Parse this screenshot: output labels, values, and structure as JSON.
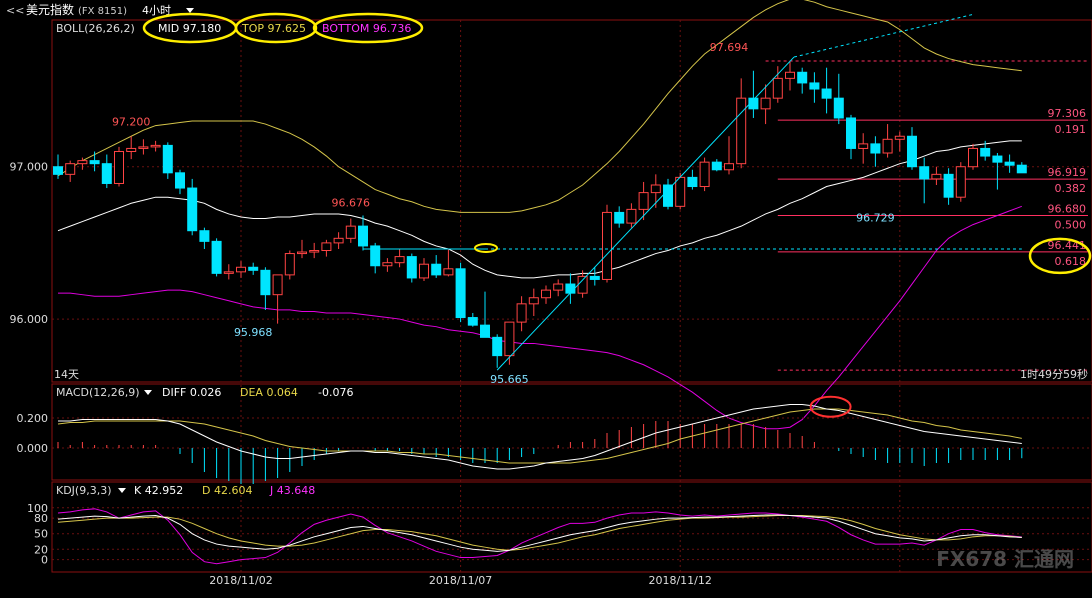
{
  "header": {
    "back_label": "<<",
    "symbol": "美元指数",
    "code": "(FX 8151)",
    "period": "4小时"
  },
  "boll": {
    "label": "BOLL(26,26,2)",
    "mid": "MID 97.180",
    "top": "TOP 97.625",
    "bottom": "BOTTOM 96.736"
  },
  "price_axis": {
    "ticks": [
      {
        "label": "97.000",
        "value": 97.0
      },
      {
        "label": "96.000",
        "value": 96.0
      }
    ],
    "ylim": [
      95.6,
      97.95
    ]
  },
  "fib_levels": [
    {
      "price": 97.694,
      "ratio": ""
    },
    {
      "price": 97.306,
      "ratio": "0.191"
    },
    {
      "price": 96.919,
      "ratio": "0.382"
    },
    {
      "price": 96.68,
      "ratio": "0.500"
    },
    {
      "price": 96.441,
      "ratio": "0.618"
    },
    {
      "price": 95.665,
      "ratio": ""
    }
  ],
  "annotations": [
    {
      "text": "97.200",
      "x": 6,
      "y": 97.27,
      "color": "#ff5555"
    },
    {
      "text": "96.676",
      "x": 24,
      "y": 96.74,
      "color": "#ff5555"
    },
    {
      "text": "95.968",
      "x": 16,
      "y": 95.89,
      "color": "#7fe0ff"
    },
    {
      "text": "95.665",
      "x": 37,
      "y": 95.58,
      "color": "#7fe0ff"
    },
    {
      "text": "97.694",
      "x": 55,
      "y": 97.76,
      "color": "#ff5555"
    },
    {
      "text": "96.729",
      "x": 67,
      "y": 96.64,
      "color": "#7fe0ff"
    }
  ],
  "panel_labels": {
    "bars_count": "14天",
    "countdown": "1时49分59秒"
  },
  "macd": {
    "label": "MACD(12,26,9)",
    "diff": "DIFF 0.026",
    "dea": "DEA 0.064",
    "macd_value": "-0.076",
    "ticks": [
      {
        "label": "0.200",
        "value": 0.2
      },
      {
        "label": "0.000",
        "value": 0.0
      }
    ],
    "ylim": [
      -0.2,
      0.32
    ]
  },
  "kdj": {
    "label": "KDJ(9,3,3)",
    "k": "K 42.952",
    "d": "D 42.604",
    "j": "J 43.648",
    "ticks": [
      {
        "label": "100",
        "value": 100
      },
      {
        "label": "80",
        "value": 80
      },
      {
        "label": "50",
        "value": 50
      },
      {
        "label": "20",
        "value": 20
      },
      {
        "label": "0",
        "value": 0
      }
    ],
    "ylim": [
      -20,
      115
    ]
  },
  "x_axis": {
    "labels": [
      {
        "text": "2018/11/02",
        "x": 15
      },
      {
        "text": "2018/11/07",
        "x": 33
      },
      {
        "text": "2018/11/12",
        "x": 51
      }
    ]
  },
  "watermark": "FX678 汇通网",
  "colors": {
    "up": "#ff4444",
    "down": "#00e5ff",
    "mid_line": "#ffffff",
    "top_line": "#d4c44a",
    "bottom_line": "#e000e0",
    "grid": "#6a1010",
    "fib": "#ff3060",
    "trend": "#00e5ff",
    "highlight_yellow": "#ffee00",
    "highlight_red": "#ff3030"
  },
  "chart_data": {
    "type": "candlestick",
    "candles": [
      [
        97.0,
        97.08,
        96.92,
        96.95
      ],
      [
        96.95,
        97.04,
        96.9,
        97.02
      ],
      [
        97.02,
        97.06,
        96.98,
        97.04
      ],
      [
        97.04,
        97.1,
        96.97,
        97.02
      ],
      [
        97.02,
        97.08,
        96.86,
        96.89
      ],
      [
        96.89,
        97.13,
        96.87,
        97.1
      ],
      [
        97.1,
        97.2,
        97.05,
        97.12
      ],
      [
        97.12,
        97.18,
        97.08,
        97.13
      ],
      [
        97.13,
        97.17,
        97.1,
        97.14
      ],
      [
        97.14,
        97.16,
        96.92,
        96.96
      ],
      [
        96.96,
        96.98,
        96.82,
        96.86
      ],
      [
        96.86,
        96.92,
        96.55,
        96.58
      ],
      [
        96.58,
        96.6,
        96.46,
        96.51
      ],
      [
        96.51,
        96.53,
        96.28,
        96.3
      ],
      [
        96.3,
        96.36,
        96.26,
        96.31
      ],
      [
        96.31,
        96.38,
        96.27,
        96.34
      ],
      [
        96.34,
        96.37,
        96.29,
        96.32
      ],
      [
        96.32,
        96.34,
        96.06,
        96.16
      ],
      [
        96.16,
        96.2,
        95.97,
        96.29
      ],
      [
        96.29,
        96.45,
        96.26,
        96.43
      ],
      [
        96.43,
        96.52,
        96.4,
        96.44
      ],
      [
        96.44,
        96.5,
        96.4,
        96.45
      ],
      [
        96.45,
        96.52,
        96.41,
        96.5
      ],
      [
        96.5,
        96.57,
        96.46,
        96.53
      ],
      [
        96.53,
        96.66,
        96.5,
        96.61
      ],
      [
        96.61,
        96.68,
        96.45,
        96.48
      ],
      [
        96.48,
        96.5,
        96.3,
        96.35
      ],
      [
        96.35,
        96.4,
        96.31,
        96.37
      ],
      [
        96.37,
        96.46,
        96.34,
        96.41
      ],
      [
        96.41,
        96.43,
        96.24,
        96.27
      ],
      [
        96.27,
        96.4,
        96.25,
        96.36
      ],
      [
        96.36,
        96.42,
        96.27,
        96.29
      ],
      [
        96.29,
        96.46,
        96.28,
        96.33
      ],
      [
        96.33,
        96.37,
        95.98,
        96.01
      ],
      [
        96.01,
        96.04,
        95.95,
        95.96
      ],
      [
        95.96,
        96.18,
        95.9,
        95.88
      ],
      [
        95.88,
        95.9,
        95.68,
        95.76
      ],
      [
        95.76,
        95.92,
        95.7,
        95.98
      ],
      [
        95.98,
        96.15,
        95.92,
        96.1
      ],
      [
        96.1,
        96.2,
        96.02,
        96.14
      ],
      [
        96.14,
        96.22,
        96.1,
        96.19
      ],
      [
        96.19,
        96.26,
        96.15,
        96.23
      ],
      [
        96.23,
        96.3,
        96.1,
        96.17
      ],
      [
        96.17,
        96.32,
        96.14,
        96.28
      ],
      [
        96.28,
        96.34,
        96.22,
        96.26
      ],
      [
        96.26,
        96.75,
        96.24,
        96.7
      ],
      [
        96.7,
        96.74,
        96.6,
        96.63
      ],
      [
        96.63,
        96.76,
        96.6,
        96.72
      ],
      [
        96.72,
        96.9,
        96.65,
        96.83
      ],
      [
        96.83,
        96.95,
        96.73,
        96.88
      ],
      [
        96.88,
        96.92,
        96.72,
        96.74
      ],
      [
        96.74,
        96.96,
        96.72,
        96.93
      ],
      [
        96.93,
        96.98,
        96.85,
        96.87
      ],
      [
        96.87,
        97.06,
        96.84,
        97.03
      ],
      [
        97.03,
        97.05,
        96.97,
        96.98
      ],
      [
        96.98,
        97.2,
        96.95,
        97.02
      ],
      [
        97.02,
        97.58,
        96.99,
        97.45
      ],
      [
        97.45,
        97.63,
        97.32,
        97.38
      ],
      [
        97.38,
        97.54,
        97.28,
        97.45
      ],
      [
        97.45,
        97.66,
        97.42,
        97.58
      ],
      [
        97.58,
        97.69,
        97.5,
        97.62
      ],
      [
        97.62,
        97.65,
        97.48,
        97.55
      ],
      [
        97.55,
        97.62,
        97.42,
        97.51
      ],
      [
        97.51,
        97.65,
        97.35,
        97.45
      ],
      [
        97.45,
        97.61,
        97.28,
        97.32
      ],
      [
        97.32,
        97.34,
        97.05,
        97.12
      ],
      [
        97.12,
        97.22,
        97.02,
        97.15
      ],
      [
        97.15,
        97.2,
        97.0,
        97.09
      ],
      [
        97.09,
        97.28,
        97.06,
        97.18
      ],
      [
        97.18,
        97.23,
        97.1,
        97.2
      ],
      [
        97.2,
        97.26,
        96.98,
        97.0
      ],
      [
        97.0,
        97.06,
        96.76,
        96.92
      ],
      [
        96.92,
        97.0,
        96.88,
        96.95
      ],
      [
        96.95,
        96.99,
        96.75,
        96.8
      ],
      [
        96.8,
        97.03,
        96.77,
        97.0
      ],
      [
        97.0,
        97.15,
        96.98,
        97.12
      ],
      [
        97.12,
        97.17,
        97.04,
        97.07
      ],
      [
        97.07,
        97.09,
        96.85,
        97.03
      ],
      [
        97.03,
        97.08,
        96.96,
        97.01
      ],
      [
        97.01,
        97.03,
        96.96,
        96.96
      ]
    ],
    "boll_mid": [
      96.58,
      96.61,
      96.64,
      96.67,
      96.7,
      96.73,
      96.76,
      96.78,
      96.8,
      96.8,
      96.79,
      96.78,
      96.76,
      96.72,
      96.69,
      96.67,
      96.66,
      96.66,
      96.67,
      96.67,
      96.68,
      96.69,
      96.69,
      96.69,
      96.68,
      96.66,
      96.63,
      96.61,
      96.58,
      96.55,
      96.51,
      96.48,
      96.46,
      96.42,
      96.36,
      96.32,
      96.29,
      96.28,
      96.27,
      96.27,
      96.28,
      96.29,
      96.29,
      96.3,
      96.3,
      96.32,
      96.34,
      96.37,
      96.4,
      96.43,
      96.45,
      96.48,
      96.5,
      96.53,
      96.55,
      96.58,
      96.61,
      96.65,
      96.69,
      96.72,
      96.76,
      96.79,
      96.83,
      96.87,
      96.89,
      96.91,
      96.93,
      96.96,
      96.99,
      97.02,
      97.04,
      97.07,
      97.1,
      97.11,
      97.13,
      97.14,
      97.15,
      97.16,
      97.17,
      97.17
    ],
    "boll_top": [
      96.94,
      96.99,
      97.04,
      97.08,
      97.12,
      97.16,
      97.2,
      97.24,
      97.27,
      97.28,
      97.29,
      97.3,
      97.3,
      97.3,
      97.3,
      97.3,
      97.3,
      97.28,
      97.25,
      97.22,
      97.18,
      97.13,
      97.07,
      97.0,
      96.95,
      96.9,
      96.85,
      96.82,
      96.79,
      96.77,
      96.74,
      96.72,
      96.71,
      96.7,
      96.7,
      96.7,
      96.7,
      96.7,
      96.71,
      96.73,
      96.75,
      96.78,
      96.83,
      96.88,
      96.95,
      97.02,
      97.1,
      97.19,
      97.28,
      97.38,
      97.48,
      97.57,
      97.66,
      97.74,
      97.8,
      97.86,
      97.92,
      97.98,
      98.03,
      98.07,
      98.1,
      98.1,
      98.08,
      98.05,
      98.03,
      98.01,
      97.99,
      97.97,
      97.95,
      97.9,
      97.84,
      97.78,
      97.74,
      97.71,
      97.69,
      97.67,
      97.66,
      97.65,
      97.64,
      97.63
    ],
    "boll_bottom": [
      96.17,
      96.17,
      96.16,
      96.15,
      96.15,
      96.15,
      96.16,
      96.17,
      96.18,
      96.19,
      96.19,
      96.18,
      96.16,
      96.14,
      96.12,
      96.1,
      96.08,
      96.07,
      96.06,
      96.06,
      96.05,
      96.05,
      96.04,
      96.04,
      96.04,
      96.03,
      96.02,
      96.01,
      96.0,
      95.98,
      95.96,
      95.95,
      95.93,
      95.92,
      95.91,
      95.89,
      95.86,
      95.85,
      95.84,
      95.84,
      95.83,
      95.82,
      95.81,
      95.8,
      95.79,
      95.78,
      95.76,
      95.73,
      95.7,
      95.66,
      95.62,
      95.57,
      95.52,
      95.46,
      95.4,
      95.35,
      95.32,
      95.3,
      95.28,
      95.28,
      95.29,
      95.34,
      95.43,
      95.53,
      95.62,
      95.72,
      95.82,
      95.92,
      96.02,
      96.12,
      96.23,
      96.34,
      96.45,
      96.53,
      96.58,
      96.62,
      96.65,
      96.68,
      96.71,
      96.74
    ],
    "macd_diff": [
      0.18,
      0.18,
      0.19,
      0.19,
      0.19,
      0.19,
      0.19,
      0.19,
      0.19,
      0.18,
      0.16,
      0.12,
      0.08,
      0.04,
      0.01,
      -0.02,
      -0.04,
      -0.06,
      -0.07,
      -0.07,
      -0.06,
      -0.05,
      -0.04,
      -0.03,
      -0.02,
      -0.02,
      -0.03,
      -0.03,
      -0.04,
      -0.05,
      -0.06,
      -0.07,
      -0.08,
      -0.1,
      -0.12,
      -0.13,
      -0.14,
      -0.14,
      -0.13,
      -0.12,
      -0.1,
      -0.09,
      -0.08,
      -0.07,
      -0.05,
      -0.02,
      0.01,
      0.04,
      0.07,
      0.1,
      0.12,
      0.14,
      0.16,
      0.18,
      0.2,
      0.22,
      0.24,
      0.26,
      0.27,
      0.28,
      0.29,
      0.29,
      0.28,
      0.26,
      0.25,
      0.23,
      0.21,
      0.19,
      0.17,
      0.15,
      0.13,
      0.11,
      0.1,
      0.09,
      0.08,
      0.07,
      0.06,
      0.05,
      0.04,
      0.03
    ],
    "macd_dea": [
      0.16,
      0.17,
      0.17,
      0.18,
      0.18,
      0.18,
      0.18,
      0.18,
      0.18,
      0.18,
      0.18,
      0.17,
      0.16,
      0.14,
      0.12,
      0.1,
      0.08,
      0.05,
      0.03,
      0.01,
      0.0,
      -0.01,
      -0.02,
      -0.02,
      -0.02,
      -0.02,
      -0.02,
      -0.02,
      -0.03,
      -0.03,
      -0.04,
      -0.04,
      -0.05,
      -0.06,
      -0.07,
      -0.08,
      -0.09,
      -0.1,
      -0.1,
      -0.1,
      -0.1,
      -0.1,
      -0.1,
      -0.09,
      -0.08,
      -0.07,
      -0.05,
      -0.03,
      -0.01,
      0.01,
      0.03,
      0.06,
      0.08,
      0.1,
      0.12,
      0.14,
      0.16,
      0.18,
      0.2,
      0.22,
      0.24,
      0.25,
      0.26,
      0.26,
      0.26,
      0.25,
      0.24,
      0.23,
      0.22,
      0.2,
      0.18,
      0.17,
      0.15,
      0.14,
      0.12,
      0.11,
      0.1,
      0.09,
      0.08,
      0.064
    ],
    "kdj_k": [
      78,
      80,
      82,
      84,
      83,
      80,
      82,
      84,
      85,
      80,
      68,
      50,
      38,
      30,
      26,
      24,
      22,
      20,
      22,
      28,
      36,
      44,
      50,
      56,
      62,
      64,
      60,
      56,
      52,
      48,
      42,
      36,
      30,
      24,
      20,
      18,
      16,
      18,
      24,
      30,
      36,
      42,
      48,
      52,
      56,
      62,
      68,
      72,
      75,
      78,
      80,
      80,
      81,
      82,
      82,
      83,
      84,
      85,
      86,
      86,
      85,
      84,
      82,
      80,
      74,
      66,
      58,
      50,
      46,
      42,
      40,
      36,
      38,
      42,
      46,
      48,
      48,
      46,
      44,
      43
    ],
    "kdj_d": [
      72,
      74,
      76,
      78,
      80,
      80,
      80,
      81,
      82,
      82,
      78,
      70,
      60,
      50,
      42,
      36,
      32,
      28,
      26,
      26,
      28,
      32,
      38,
      44,
      50,
      56,
      58,
      58,
      56,
      54,
      50,
      46,
      40,
      34,
      28,
      24,
      20,
      18,
      20,
      24,
      28,
      32,
      38,
      44,
      48,
      54,
      60,
      64,
      68,
      72,
      76,
      78,
      80,
      80,
      81,
      82,
      82,
      83,
      84,
      85,
      85,
      85,
      84,
      83,
      80,
      75,
      68,
      60,
      54,
      48,
      44,
      40,
      38,
      38,
      40,
      44,
      46,
      46,
      45,
      42.6
    ],
    "kdj_j": [
      90,
      92,
      96,
      98,
      92,
      80,
      86,
      92,
      94,
      76,
      48,
      14,
      -4,
      -8,
      -4,
      0,
      2,
      4,
      14,
      32,
      52,
      68,
      76,
      82,
      88,
      82,
      66,
      52,
      44,
      36,
      26,
      16,
      10,
      4,
      4,
      6,
      8,
      18,
      32,
      42,
      52,
      62,
      70,
      70,
      72,
      80,
      86,
      90,
      90,
      92,
      90,
      86,
      84,
      86,
      84,
      86,
      88,
      90,
      90,
      88,
      85,
      82,
      78,
      74,
      62,
      48,
      38,
      30,
      30,
      30,
      32,
      28,
      38,
      50,
      58,
      58,
      52,
      48,
      46,
      43.6
    ]
  }
}
